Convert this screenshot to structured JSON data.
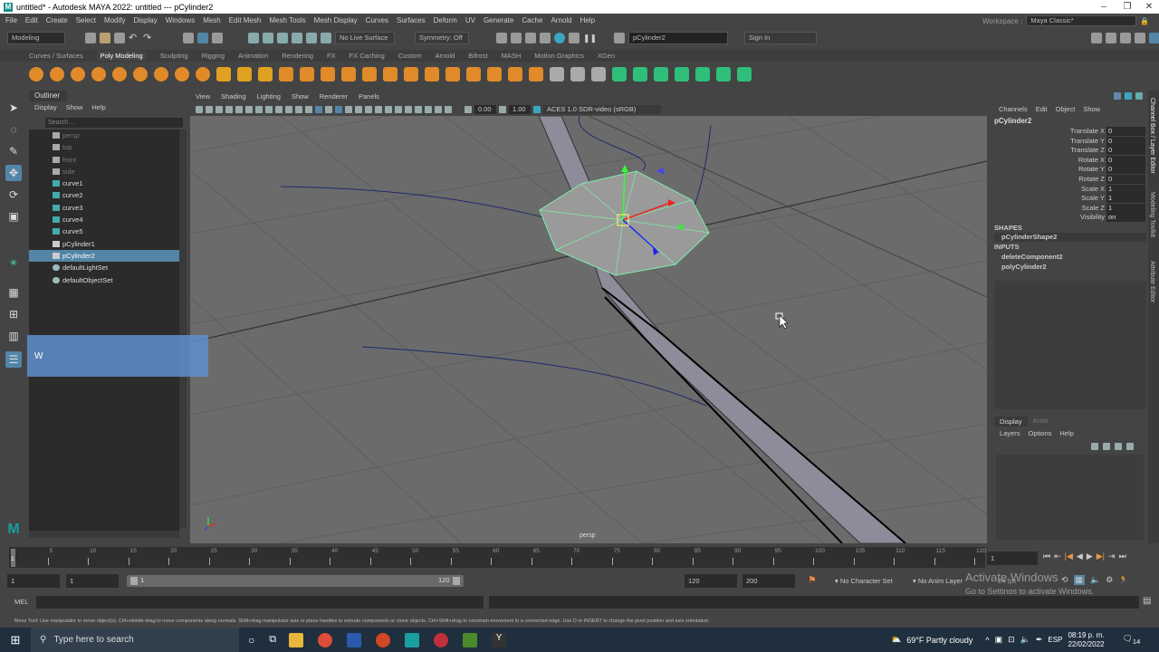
{
  "window": {
    "title": "untitled* - Autodesk MAYA 2022: untitled  ---  pCylinder2",
    "minimize": "–",
    "maximize": "❐",
    "close": "✕"
  },
  "menu": [
    "File",
    "Edit",
    "Create",
    "Select",
    "Modify",
    "Display",
    "Windows",
    "Mesh",
    "Edit Mesh",
    "Mesh Tools",
    "Mesh Display",
    "Curves",
    "Surfaces",
    "Deform",
    "UV",
    "Generate",
    "Cache",
    "Arnold",
    "Help"
  ],
  "workspace": {
    "label": "Workspace :",
    "value": "Maya Classic*"
  },
  "statusline": {
    "mode": "Modeling",
    "live_surface": "No Live Surface",
    "symmetry": "Symmetry: Off",
    "object_field": "pCylinder2",
    "sign_in": "Sign In"
  },
  "shelf_tabs": [
    "Curves / Surfaces",
    "Poly Modeling",
    "Sculpting",
    "Rigging",
    "Animation",
    "Rendering",
    "FX",
    "FX Caching",
    "Custom",
    "Arnold",
    "Bifrost",
    "MASH",
    "Motion Graphics",
    "XGen"
  ],
  "shelf_active": "Poly Modeling",
  "outliner": {
    "tab": "Outliner",
    "menu": [
      "Display",
      "Show",
      "Help"
    ],
    "search_placeholder": "Search...",
    "items": [
      {
        "label": "persp",
        "type": "camera"
      },
      {
        "label": "top",
        "type": "camera"
      },
      {
        "label": "front",
        "type": "camera"
      },
      {
        "label": "side",
        "type": "camera"
      },
      {
        "label": "curve1",
        "type": "curve"
      },
      {
        "label": "curve2",
        "type": "curve"
      },
      {
        "label": "curve3",
        "type": "curve"
      },
      {
        "label": "curve4",
        "type": "curve"
      },
      {
        "label": "curve5",
        "type": "curve"
      },
      {
        "label": "pCylinder1",
        "type": "mesh"
      },
      {
        "label": "pCylinder2",
        "type": "mesh",
        "selected": true
      },
      {
        "label": "defaultLightSet",
        "type": "set"
      },
      {
        "label": "defaultObjectSet",
        "type": "set"
      }
    ]
  },
  "overlay_key": "W",
  "viewport": {
    "menu": [
      "View",
      "Shading",
      "Lighting",
      "Show",
      "Renderer",
      "Panels"
    ],
    "exposure": "0.00",
    "gamma": "1.00",
    "color_space": "ACES 1.0 SDR-video (sRGB)",
    "camera_label": "persp"
  },
  "channel_box": {
    "menu": [
      "Channels",
      "Edit",
      "Object",
      "Show"
    ],
    "object": "pCylinder2",
    "channels": [
      {
        "name": "Translate X",
        "value": "0"
      },
      {
        "name": "Translate Y",
        "value": "0"
      },
      {
        "name": "Translate Z",
        "value": "0"
      },
      {
        "name": "Rotate X",
        "value": "0"
      },
      {
        "name": "Rotate Y",
        "value": "0"
      },
      {
        "name": "Rotate Z",
        "value": "0"
      },
      {
        "name": "Scale X",
        "value": "1"
      },
      {
        "name": "Scale Y",
        "value": "1"
      },
      {
        "name": "Scale Z",
        "value": "1"
      },
      {
        "name": "Visibility",
        "value": "on"
      }
    ],
    "shapes_header": "SHAPES",
    "shape": "pCylinderShape2",
    "inputs_header": "INPUTS",
    "inputs": [
      "deleteComponent2",
      "polyCylinder2"
    ]
  },
  "layer_editor": {
    "tabs": [
      "Display",
      "Anim"
    ],
    "menu": [
      "Layers",
      "Options",
      "Help"
    ]
  },
  "side_tabs": [
    "Channel Box / Layer Editor",
    "Modeling Toolkit",
    "Attribute Editor"
  ],
  "timeline": {
    "ticks": [
      "5",
      "10",
      "15",
      "20",
      "25",
      "30",
      "35",
      "40",
      "45",
      "50",
      "55",
      "60",
      "65",
      "70",
      "75",
      "80",
      "85",
      "90",
      "95",
      "100",
      "105",
      "110",
      "115",
      "120"
    ],
    "current_frame_marker": "1",
    "current_frame": "1"
  },
  "range": {
    "start": "1",
    "playback_start": "1",
    "slider_start": "1",
    "slider_end": "120",
    "playback_end": "120",
    "end": "200",
    "character_set": "No Character Set",
    "anim_layer": "No Anim Layer",
    "fps": "24 fps"
  },
  "activation": {
    "line1": "Activate Windows",
    "line2": "Go to Settings to activate Windows."
  },
  "mel_label": "MEL",
  "help_line": "Move Tool: Use manipulator to move object(s). Ctrl+middle-drag to move components along normals. Shift+drag manipulator axis or plane handles to extrude components or clone objects. Ctrl+Shift+drag to constrain movement to a connected edge. Use D or INSERT to change the pivot position and axis orientation.",
  "taskbar": {
    "search_placeholder": "Type here to search",
    "weather": "69°F  Partly cloudy",
    "language": "ESP",
    "time": "08:19 p. m.",
    "date": "22/02/2022",
    "notifications": "14"
  },
  "colors": {
    "selection": "#5285a6",
    "viewport_bg": "#6b6b6b",
    "mesh_highlight": "#7cf0a8"
  }
}
